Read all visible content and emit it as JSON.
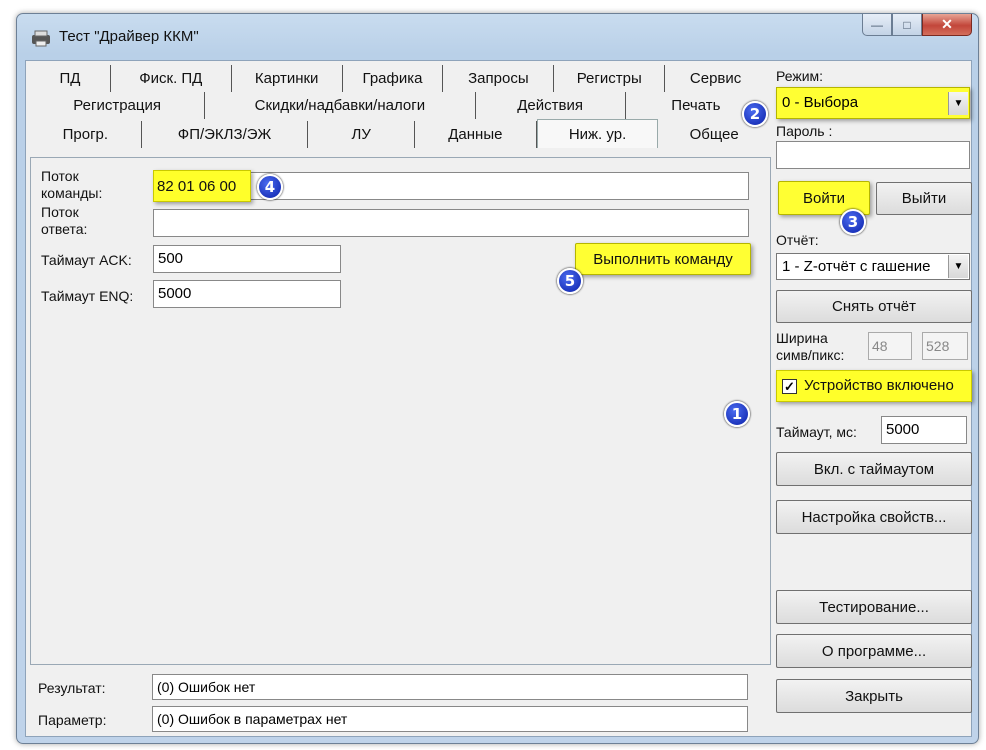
{
  "window": {
    "title": "Тест \"Драйвер ККМ\"",
    "min_icon": "minimize-icon",
    "max_icon": "maximize-icon",
    "close_icon": "close-icon"
  },
  "tabs": {
    "row1": [
      "ПД",
      "Фиск. ПД",
      "Картинки",
      "Графика",
      "Запросы",
      "Регистры",
      "Сервис"
    ],
    "row2": [
      "Регистрация",
      "Скидки/надбавки/налоги",
      "Действия",
      "Печать"
    ],
    "row3": [
      "Прогр.",
      "ФП/ЭКЛЗ/ЭЖ",
      "ЛУ",
      "Данные",
      "Ниж. ур.",
      "Общее"
    ],
    "active": "Ниж. ур."
  },
  "main": {
    "command_label_1": "Поток",
    "command_label_2": "команды:",
    "command_value": "82 01 06 00",
    "response_label_1": "Поток",
    "response_label_2": "ответа:",
    "response_value": "",
    "ack_label": "Таймаут ACK:",
    "ack_value": "500",
    "enq_label": "Таймаут ENQ:",
    "enq_value": "5000",
    "execute_button": "Выполнить команду"
  },
  "bottom": {
    "result_label": "Результат:",
    "result_value": "(0) Ошибок нет",
    "param_label": "Параметр:",
    "param_value": "(0) Ошибок в параметрах нет"
  },
  "right": {
    "mode_label": "Режим:",
    "mode_value": "0 - Выбора",
    "password_label": "Пароль :",
    "password_value": "",
    "login_button": "Войти",
    "logout_button": "Выйти",
    "report_label": "Отчёт:",
    "report_value": "1 - Z-отчёт с гашение",
    "take_report_button": "Снять отчёт",
    "width_label_1": "Ширина",
    "width_label_2": "симв/пикс:",
    "width_chars": "48",
    "width_pixels": "528",
    "device_enabled_label": "Устройство включено",
    "device_enabled": true,
    "timeout_label": "Таймаут, мс:",
    "timeout_value": "5000",
    "timeout_on_button": "Вкл. с таймаутом",
    "properties_button": "Настройка свойств...",
    "testing_button": "Тестирование...",
    "about_button": "О программе...",
    "close_button": "Закрыть"
  },
  "markers": [
    "1",
    "2",
    "3",
    "4",
    "5"
  ],
  "colors": {
    "highlight": "#ffff33",
    "marker": "#0a1fa8"
  }
}
